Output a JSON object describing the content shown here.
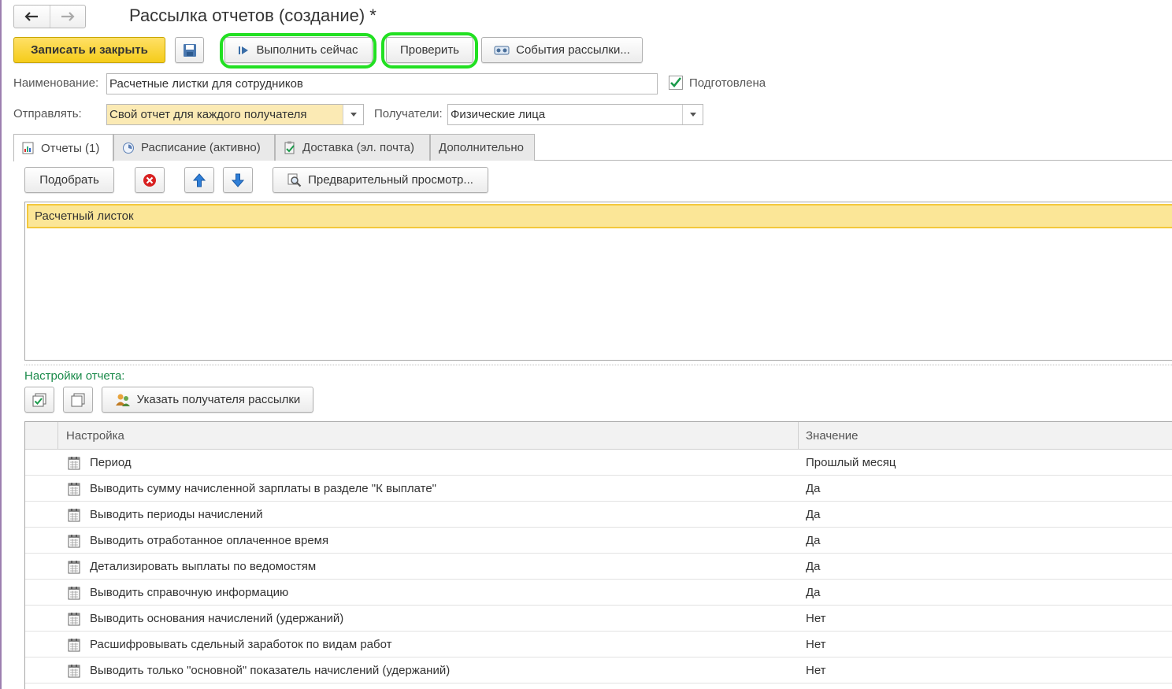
{
  "window": {
    "title": "Рассылка отчетов (создание) *"
  },
  "toolbar": {
    "save_close": "Записать и закрыть",
    "run_now": "Выполнить сейчас",
    "check": "Проверить",
    "events": "События рассылки..."
  },
  "form": {
    "name_label": "Наименование:",
    "name_value": "Расчетные листки для сотрудников",
    "prepared_label": "Подготовлена",
    "prepared_checked": true,
    "send_label": "Отправлять:",
    "send_value": "Свой отчет для каждого получателя",
    "recipients_label": "Получатели:",
    "recipients_value": "Физические лица"
  },
  "tabs": [
    {
      "label": "Отчеты (1)",
      "icon": "report-icon",
      "active": true
    },
    {
      "label": "Расписание (активно)",
      "icon": "schedule-icon",
      "active": false
    },
    {
      "label": "Доставка (эл. почта)",
      "icon": "delivery-icon",
      "active": false
    },
    {
      "label": "Дополнительно",
      "icon": "",
      "active": false
    }
  ],
  "reports_toolbar": {
    "pick": "Подобрать",
    "preview": "Предварительный просмотр..."
  },
  "reports_list": [
    "Расчетный листок"
  ],
  "settings": {
    "section_label": "Настройки отчета:",
    "set_recipient": "Указать получателя рассылки",
    "col_setting": "Настройка",
    "col_value": "Значение",
    "rows": [
      {
        "name": "Период",
        "value": "Прошлый месяц"
      },
      {
        "name": "Выводить сумму начисленной зарплаты в разделе \"К выплате\"",
        "value": "Да"
      },
      {
        "name": "Выводить периоды начислений",
        "value": "Да"
      },
      {
        "name": "Выводить отработанное оплаченное время",
        "value": "Да"
      },
      {
        "name": "Детализировать выплаты по ведомостям",
        "value": "Да"
      },
      {
        "name": "Выводить справочную информацию",
        "value": "Да"
      },
      {
        "name": "Выводить основания начислений (удержаний)",
        "value": "Нет"
      },
      {
        "name": "Расшифровывать сдельный заработок по видам работ",
        "value": "Нет"
      },
      {
        "name": "Выводить только \"основной\" показатель начислений (удержаний)",
        "value": "Нет"
      }
    ]
  },
  "colors": {
    "primary_button": "#f5cc1a",
    "highlight_ring": "#22e022",
    "selected_row": "#fbe697",
    "section_label": "#1a8a4a"
  }
}
